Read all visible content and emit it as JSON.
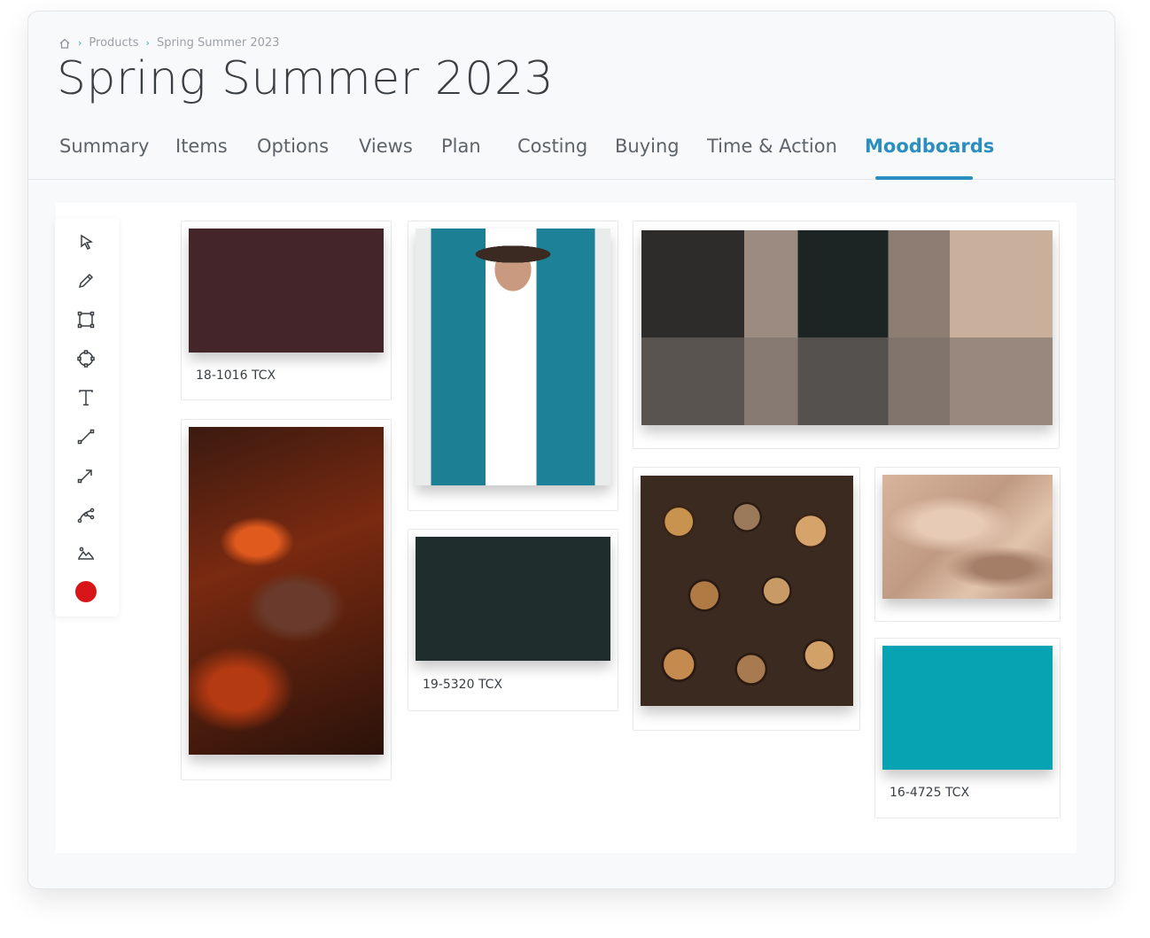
{
  "breadcrumb": {
    "home_icon": "home-icon",
    "items": [
      "Products",
      "Spring Summer 2023"
    ]
  },
  "page": {
    "title": "Spring Summer 2023"
  },
  "tabs": [
    {
      "label": "Summary",
      "active": false
    },
    {
      "label": "Items",
      "active": false
    },
    {
      "label": "Options",
      "active": false
    },
    {
      "label": "Views",
      "active": false
    },
    {
      "label": "Plan",
      "active": false
    },
    {
      "label": "Costing",
      "active": false
    },
    {
      "label": "Buying",
      "active": false
    },
    {
      "label": "Time & Action",
      "active": false
    },
    {
      "label": "Moodboards",
      "active": true
    }
  ],
  "colors": {
    "accent": "#2a8fc0",
    "selected_tool_color": "#d8161a"
  },
  "toolbar": {
    "tools": [
      "select-arrow-icon",
      "pencil-icon",
      "rectangle-icon",
      "circle-icon",
      "text-icon",
      "line-icon",
      "arrow-icon",
      "bezier-curve-icon",
      "image-icon"
    ],
    "current_color": "#d8161a"
  },
  "moodboard": {
    "swatches": [
      {
        "code": "18-1016 TCX",
        "color": "#44262a"
      },
      {
        "code": "19-5320 TCX",
        "color": "#1f2e2d"
      },
      {
        "code": "16-4725 TCX",
        "color": "#07a3b3"
      }
    ],
    "images": [
      "denim-jacket-model",
      "woman-black-dress-street",
      "autumn-leaves",
      "stacked-logs",
      "burlap-fabric"
    ]
  }
}
